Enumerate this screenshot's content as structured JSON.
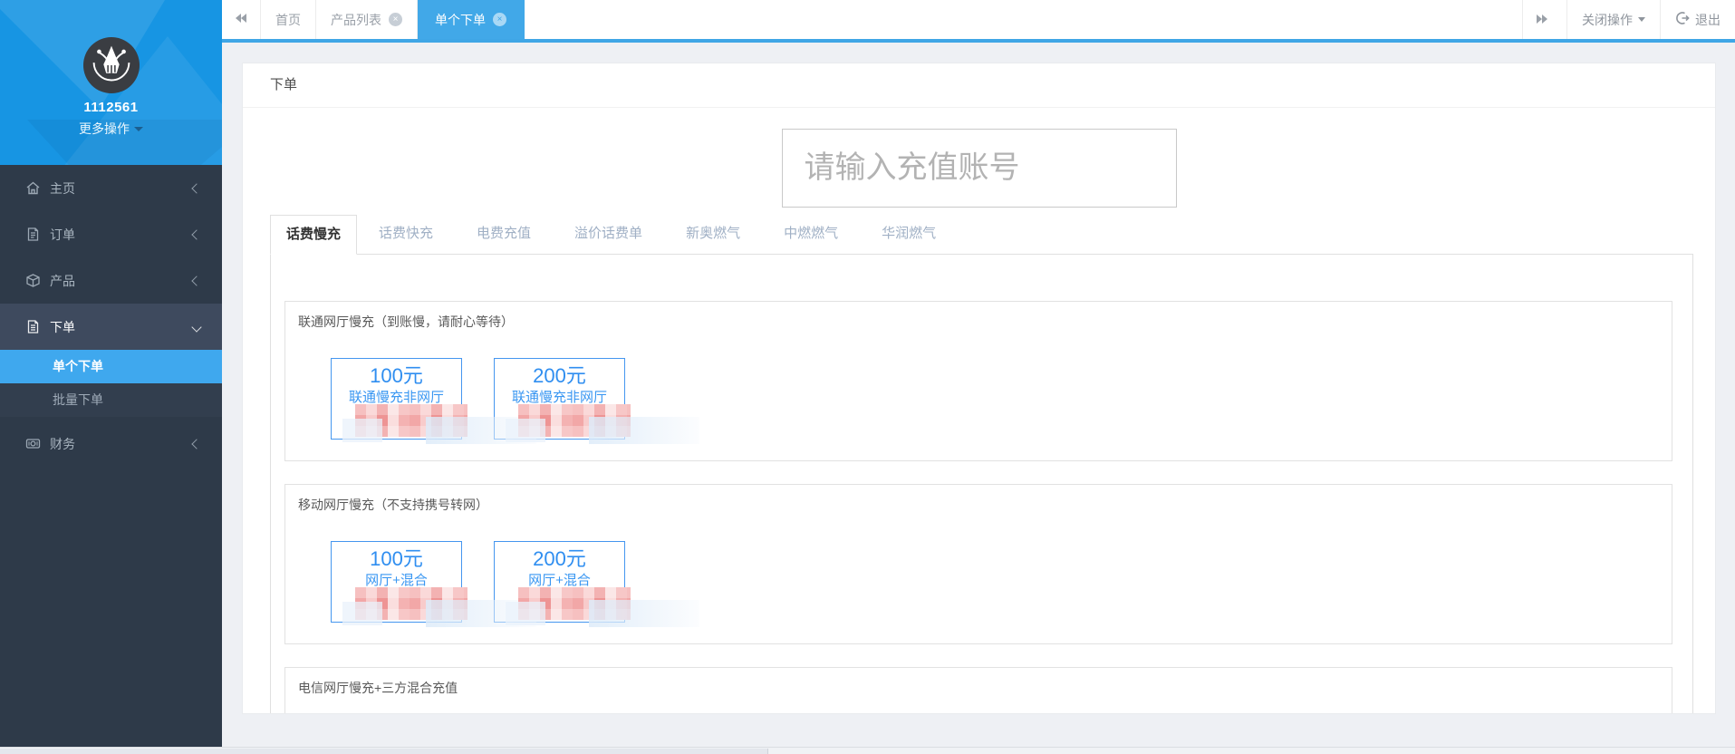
{
  "colors": {
    "topbar_accent": "#3fa6e6",
    "active_tab_blue": "#41a8e8",
    "sidebar_header_blue": "#1795e3",
    "sidebar_bg": "#2e3a49",
    "submenu_active_blue": "#3fa8ee",
    "product_blue": "#3a97f2",
    "redaction_pink": "#f2a7a7"
  },
  "topbar": {
    "collapse_icon": "double-chevron-left-icon",
    "expand_icon": "double-chevron-right-icon",
    "tabs": [
      {
        "id": "home",
        "label": "首页",
        "closable": false,
        "active": false
      },
      {
        "id": "product-list",
        "label": "产品列表",
        "closable": true,
        "active": false
      },
      {
        "id": "single-order",
        "label": "单个下单",
        "closable": true,
        "active": true
      }
    ],
    "close_ops_label": "关闭操作",
    "logout_label": "退出"
  },
  "sidebar": {
    "user_id": "1112561",
    "more_actions_label": "更多操作",
    "menu": [
      {
        "id": "home",
        "label": "主页",
        "icon": "home-icon",
        "state": "collapsed",
        "active": false
      },
      {
        "id": "orders",
        "label": "订单",
        "icon": "order-doc-icon",
        "state": "collapsed",
        "active": false
      },
      {
        "id": "products",
        "label": "产品",
        "icon": "product-box-icon",
        "state": "collapsed",
        "active": false
      },
      {
        "id": "place-order",
        "label": "下单",
        "icon": "place-order-doc-icon",
        "state": "expanded",
        "active": true,
        "children": [
          {
            "id": "single-order",
            "label": "单个下单",
            "active": true
          },
          {
            "id": "batch-order",
            "label": "批量下单",
            "active": false
          }
        ]
      },
      {
        "id": "finance",
        "label": "财务",
        "icon": "finance-money-icon",
        "state": "collapsed",
        "active": false
      }
    ]
  },
  "main": {
    "panel_title": "下单",
    "account_placeholder": "请输入充值账号",
    "product_tabs": [
      {
        "id": "phone-slow",
        "label": "话费慢充",
        "active": true
      },
      {
        "id": "phone-fast",
        "label": "话费快充",
        "active": false
      },
      {
        "id": "electricity",
        "label": "电费充值",
        "active": false
      },
      {
        "id": "premium-phone",
        "label": "溢价话费单",
        "active": false
      },
      {
        "id": "xinao-gas",
        "label": "新奥燃气",
        "active": false
      },
      {
        "id": "zhongran-gas",
        "label": "中燃燃气",
        "active": false
      },
      {
        "id": "huarun-gas",
        "label": "华润燃气",
        "active": false
      }
    ],
    "sections": [
      {
        "id": "unicom-slow",
        "title": "联通网厅慢充（到账慢，请耐心等待）",
        "products": [
          {
            "amount": "100元",
            "name": "联通慢充非网厅",
            "price_redacted": true
          },
          {
            "amount": "200元",
            "name": "联通慢充非网厅",
            "price_redacted": true
          }
        ]
      },
      {
        "id": "mobile-slow",
        "title": "移动网厅慢充（不支持携号转网）",
        "products": [
          {
            "amount": "100元",
            "name": "网厅+混合",
            "price_redacted": true
          },
          {
            "amount": "200元",
            "name": "网厅+混合",
            "price_redacted": true
          }
        ]
      },
      {
        "id": "telecom-slow",
        "title": "电信网厅慢充+三方混合充值",
        "products": []
      }
    ]
  }
}
